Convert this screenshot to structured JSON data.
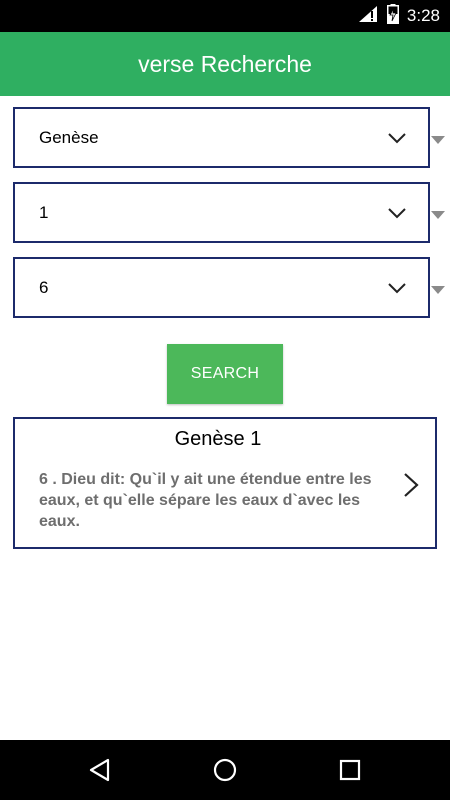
{
  "status_bar": {
    "time": "3:28",
    "icons": [
      "signal-icon",
      "battery-charging-icon"
    ]
  },
  "app_bar": {
    "title": "verse Recherche",
    "color": "#2faf61"
  },
  "spinners": [
    {
      "name": "book",
      "value": "Genèse"
    },
    {
      "name": "chapter",
      "value": "1"
    },
    {
      "name": "verse",
      "value": "6"
    }
  ],
  "search_button": {
    "label": "SEARCH",
    "color": "#4cb85a"
  },
  "result": {
    "title": "Genèse 1",
    "text": "6 . Dieu dit: Qu`il y ait une étendue entre les eaux, et qu`elle sépare les eaux d`avec les eaux."
  },
  "nav_bar": {
    "buttons": [
      "back-icon",
      "home-icon",
      "recents-icon"
    ]
  },
  "colors": {
    "border": "#1c2a6b",
    "result_text": "#6e6e6e"
  }
}
